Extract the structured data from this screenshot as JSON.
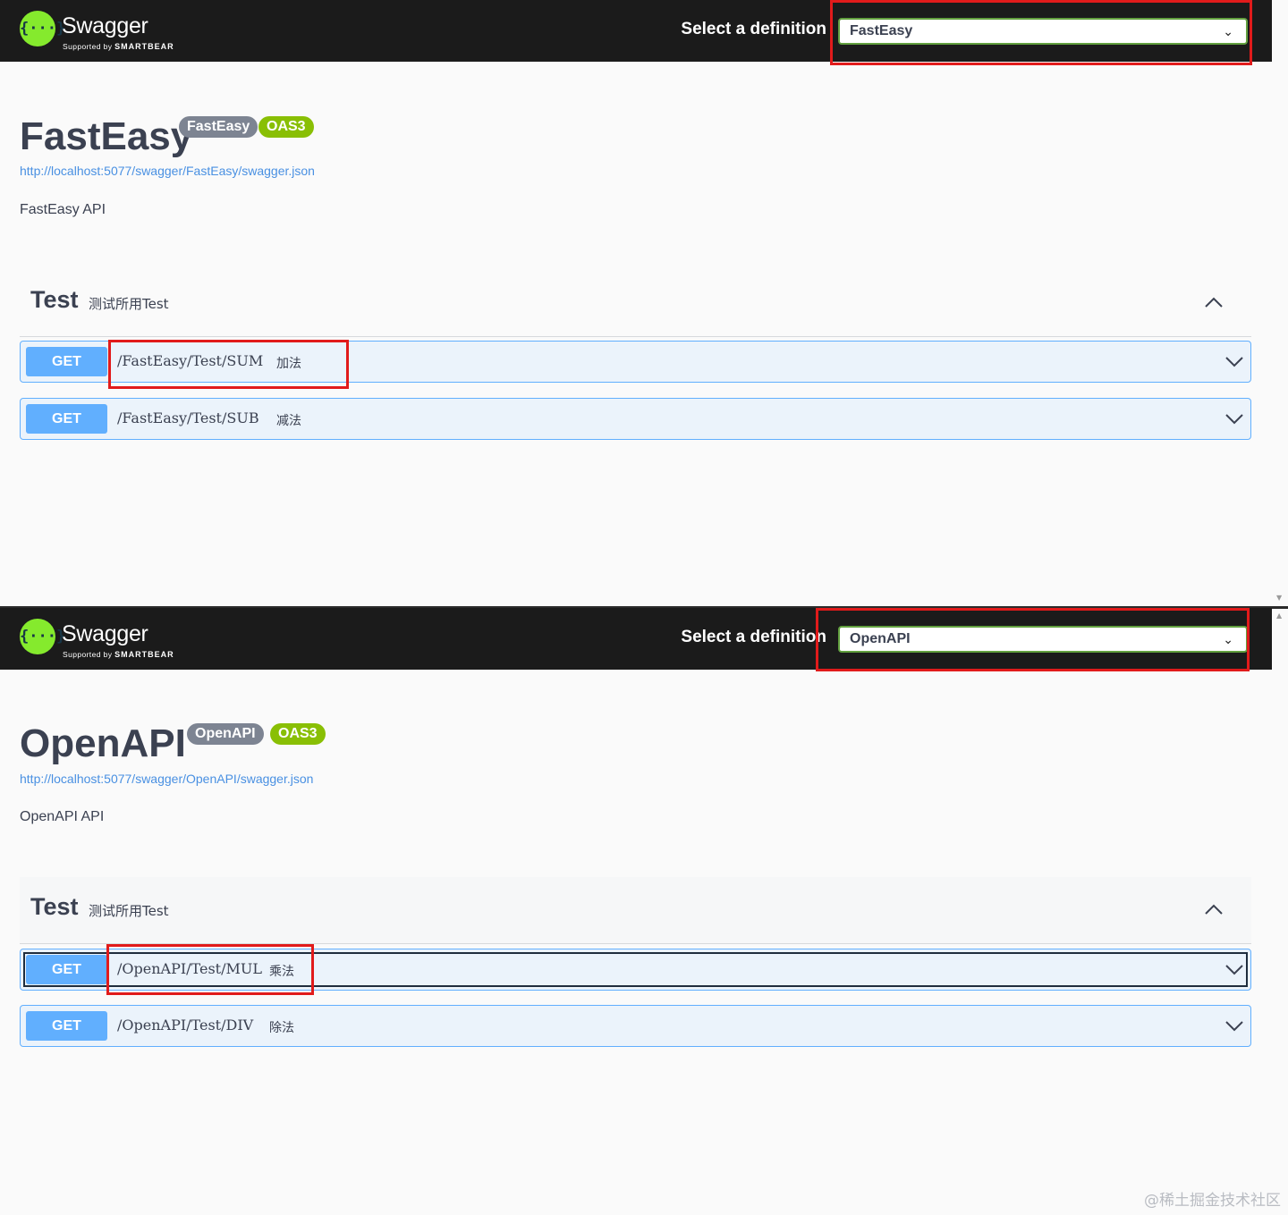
{
  "header": {
    "brand": "Swagger",
    "brand_sub_prefix": "Supported by",
    "brand_sub_company": "SMARTBEAR",
    "select_label": "Select a definition",
    "dropdown_icon": "chevron-down-icon"
  },
  "panels": [
    {
      "selected_definition": "FastEasy",
      "title": "FastEasy",
      "version_badge": "FastEasy",
      "oas_badge": "OAS3",
      "spec_url": "http://localhost:5077/swagger/FastEasy/swagger.json",
      "description": "FastEasy API",
      "tag": {
        "name": "Test",
        "description": "测试所用Test"
      },
      "operations": [
        {
          "method": "GET",
          "path": "/FastEasy/Test/SUM",
          "summary": "加法"
        },
        {
          "method": "GET",
          "path": "/FastEasy/Test/SUB",
          "summary": "减法"
        }
      ]
    },
    {
      "selected_definition": "OpenAPI",
      "title": "OpenAPI",
      "version_badge": "OpenAPI",
      "oas_badge": "OAS3",
      "spec_url": "http://localhost:5077/swagger/OpenAPI/swagger.json",
      "description": "OpenAPI API",
      "tag": {
        "name": "Test",
        "description": "测试所用Test"
      },
      "operations": [
        {
          "method": "GET",
          "path": "/OpenAPI/Test/MUL",
          "summary": "乘法"
        },
        {
          "method": "GET",
          "path": "/OpenAPI/Test/DIV",
          "summary": "除法"
        }
      ]
    }
  ],
  "colors": {
    "topbar": "#1b1b1b",
    "logo": "#85ea2d",
    "get_method": "#61affe",
    "get_background": "#ebf3fb",
    "oas_badge": "#89bf04",
    "version_badge": "#7d8492",
    "link": "#4990e2",
    "highlight_box": "#e11b1b"
  },
  "watermark": "@稀土掘金技术社区"
}
